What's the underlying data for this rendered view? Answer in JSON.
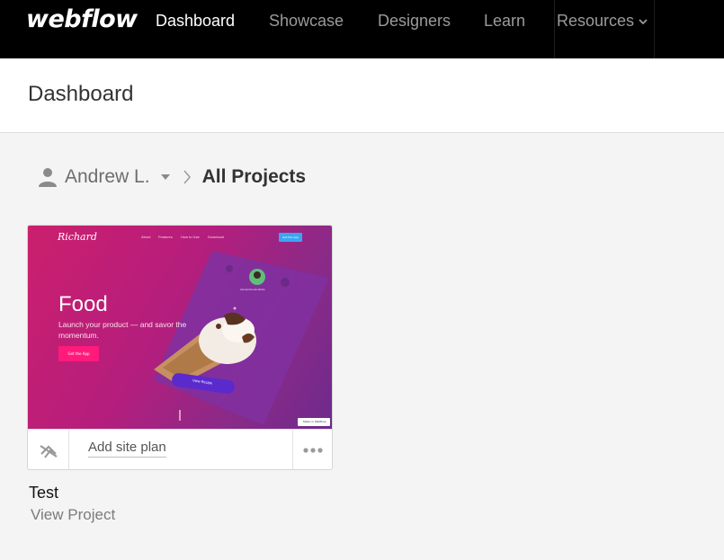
{
  "nav": {
    "logo": "webflow",
    "items": [
      {
        "label": "Dashboard",
        "active": true
      },
      {
        "label": "Showcase",
        "active": false
      },
      {
        "label": "Designers",
        "active": false
      },
      {
        "label": "Learn",
        "active": false
      },
      {
        "label": "Resources",
        "active": false
      }
    ]
  },
  "header": {
    "title": "Dashboard"
  },
  "breadcrumb": {
    "user": "Andrew L.",
    "current": "All Projects"
  },
  "project": {
    "name": "Test",
    "view_label": "View Project",
    "add_plan_label": "Add site plan",
    "thumbnail": {
      "logo": "Richard",
      "nav": [
        "About",
        "Features",
        "How to Use",
        "Download"
      ],
      "cta": "Get the App",
      "title": "Food",
      "subtitle": "Launch your product — and savor the momentum.",
      "button": "Get the App",
      "phone_name": "Alexandra Hendricks",
      "phone_button": "View Recipe",
      "badge": "Made in Webflow"
    }
  },
  "colors": {
    "nav_bg": "#000000",
    "thumb_accent": "#cc1f6d",
    "cta_blue": "#3aa6f0"
  }
}
